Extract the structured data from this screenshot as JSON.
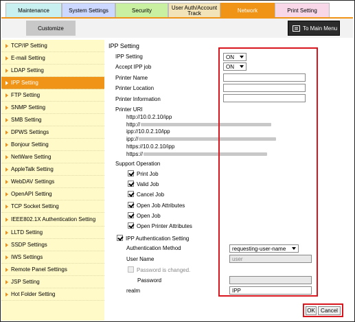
{
  "tabs": [
    {
      "label": "Maintenance"
    },
    {
      "label": "System Settings"
    },
    {
      "label": "Security"
    },
    {
      "label": "User Auth/Account Track"
    },
    {
      "label": "Network"
    },
    {
      "label": "Print Setting"
    }
  ],
  "subbar": {
    "customize": "Customize",
    "main_menu": "To Main Menu"
  },
  "sidebar": {
    "items": [
      {
        "label": "TCP/IP Setting"
      },
      {
        "label": "E-mail Setting"
      },
      {
        "label": "LDAP Setting"
      },
      {
        "label": "IPP Setting"
      },
      {
        "label": "FTP Setting"
      },
      {
        "label": "SNMP Setting"
      },
      {
        "label": "SMB Setting"
      },
      {
        "label": "DPWS Settings"
      },
      {
        "label": "Bonjour Setting"
      },
      {
        "label": "NetWare Setting"
      },
      {
        "label": "AppleTalk Setting"
      },
      {
        "label": "WebDAV Settings"
      },
      {
        "label": "OpenAPI Setting"
      },
      {
        "label": "TCP Socket Setting"
      },
      {
        "label": "IEEE802.1X Authentication Setting"
      },
      {
        "label": "LLTD Setting"
      },
      {
        "label": "SSDP Settings"
      },
      {
        "label": "IWS Settings"
      },
      {
        "label": "Remote Panel Settings"
      },
      {
        "label": "JSP Setting"
      },
      {
        "label": "Hot Folder Setting"
      }
    ]
  },
  "ipp": {
    "title": "IPP Setting",
    "ipp_setting_label": "IPP Setting",
    "ipp_setting_value": "ON",
    "accept_label": "Accept IPP job",
    "accept_value": "ON",
    "printer_name_label": "Printer Name",
    "printer_location_label": "Printer Location",
    "printer_info_label": "Printer Information",
    "printer_uri_label": "Printer URI",
    "uris": [
      "http://10.0.2.10/ipp",
      "http://",
      "ipp://10.0.2.10/ipp",
      "ipp://",
      "https://10.0.2.10/ipp",
      "https://"
    ],
    "support_operation_label": "Support Operation",
    "operations": [
      "Print Job",
      "Valid Job",
      "Cancel Job",
      "Open Job Attributes",
      "Open Job",
      "Open Printer Attributes"
    ],
    "auth_setting_label": "IPP Authentication Setting",
    "auth_method_label": "Authentication Method",
    "auth_method_value": "requesting-user-name",
    "user_name_label": "User Name",
    "user_name_value": "user",
    "password_changed_label": "Password is changed.",
    "password_label": "Password",
    "realm_label": "realm",
    "realm_value": "IPP"
  },
  "footer": {
    "ok": "OK",
    "cancel": "Cancel"
  },
  "colors": {
    "accent": "#f09418",
    "highlight": "#d8141c",
    "sidebar_bg": "#fffac8"
  }
}
